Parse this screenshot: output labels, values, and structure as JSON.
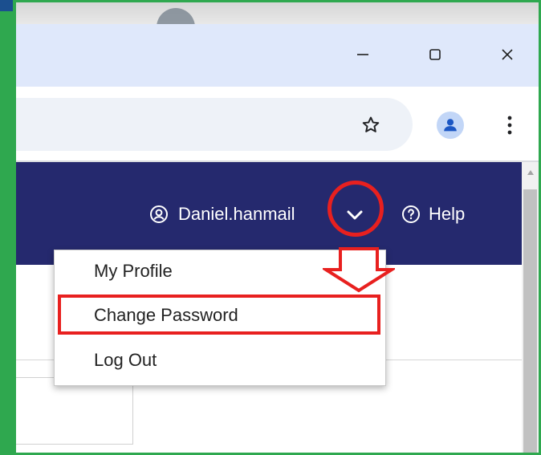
{
  "window": {
    "minimize_label": "Minimize",
    "maximize_label": "Maximize",
    "close_label": "Close"
  },
  "toolbar": {
    "icons": [
      "star-icon",
      "profile-icon",
      "more-vert-icon"
    ]
  },
  "header": {
    "user_name": "Daniel.hanmail",
    "help_label": "Help"
  },
  "dropdown": {
    "items": [
      {
        "label": "My Profile"
      },
      {
        "label": "Change Password"
      },
      {
        "label": "Log Out"
      }
    ]
  },
  "colors": {
    "header_bg": "#25296e",
    "annotation_red": "#e8201f",
    "frame_green": "#2fa84f"
  }
}
